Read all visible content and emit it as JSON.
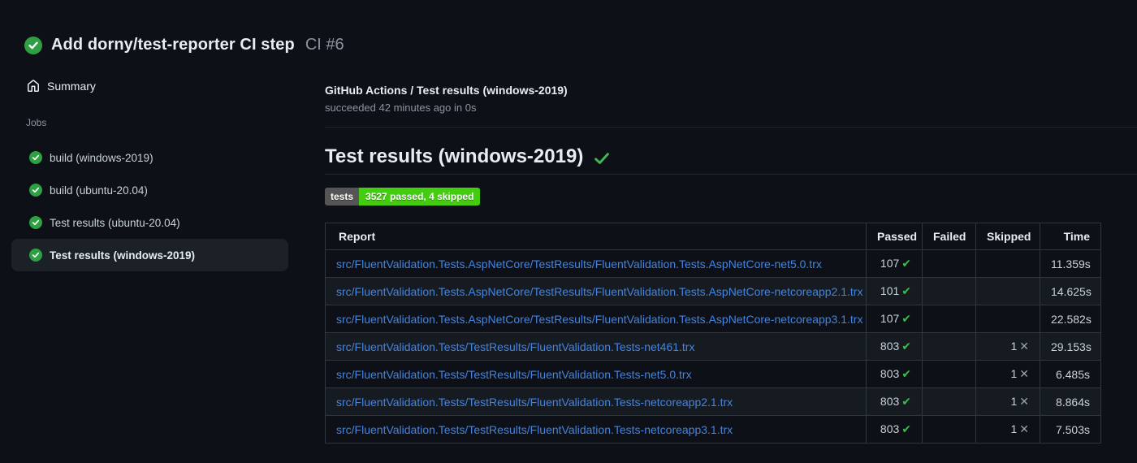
{
  "colors": {
    "background": "#0d1117",
    "selected_item_bg": "#1c2128",
    "text_primary": "#e6edf3",
    "text_secondary": "#8b949e",
    "link_blue": "#4184e4",
    "success_green": "#3fb950",
    "status_circle_green": "#2ea043",
    "badge_label_bg": "#555555",
    "badge_value_bg": "#44cc11",
    "table_border": "#30363d",
    "row_alt_bg": "#161b22"
  },
  "header": {
    "title": "Add dorny/test-reporter CI step",
    "run_number": "CI #6"
  },
  "sidebar": {
    "summary_label": "Summary",
    "jobs_section_label": "Jobs",
    "jobs": [
      {
        "label": "build (windows-2019)",
        "status": "success",
        "selected": false
      },
      {
        "label": "build (ubuntu-20.04)",
        "status": "success",
        "selected": false
      },
      {
        "label": "Test results (ubuntu-20.04)",
        "status": "success",
        "selected": false
      },
      {
        "label": "Test results (windows-2019)",
        "status": "success",
        "selected": true
      }
    ]
  },
  "main": {
    "check_title": "GitHub Actions / Test results (windows-2019)",
    "check_subtitle": "succeeded 42 minutes ago in 0s",
    "section_heading": "Test results (windows-2019)",
    "badge": {
      "label": "tests",
      "value": "3527 passed, 4 skipped"
    },
    "table": {
      "headers": [
        "Report",
        "Passed",
        "Failed",
        "Skipped",
        "Time"
      ],
      "rows": [
        {
          "report": "src/FluentValidation.Tests.AspNetCore/TestResults/FluentValidation.Tests.AspNetCore-net5.0.trx",
          "passed": "107",
          "failed": "",
          "skipped": "",
          "time": "11.359s"
        },
        {
          "report": "src/FluentValidation.Tests.AspNetCore/TestResults/FluentValidation.Tests.AspNetCore-netcoreapp2.1.trx",
          "passed": "101",
          "failed": "",
          "skipped": "",
          "time": "14.625s"
        },
        {
          "report": "src/FluentValidation.Tests.AspNetCore/TestResults/FluentValidation.Tests.AspNetCore-netcoreapp3.1.trx",
          "passed": "107",
          "failed": "",
          "skipped": "",
          "time": "22.582s"
        },
        {
          "report": "src/FluentValidation.Tests/TestResults/FluentValidation.Tests-net461.trx",
          "passed": "803",
          "failed": "",
          "skipped": "1",
          "time": "29.153s"
        },
        {
          "report": "src/FluentValidation.Tests/TestResults/FluentValidation.Tests-net5.0.trx",
          "passed": "803",
          "failed": "",
          "skipped": "1",
          "time": "6.485s"
        },
        {
          "report": "src/FluentValidation.Tests/TestResults/FluentValidation.Tests-netcoreapp2.1.trx",
          "passed": "803",
          "failed": "",
          "skipped": "1",
          "time": "8.864s"
        },
        {
          "report": "src/FluentValidation.Tests/TestResults/FluentValidation.Tests-netcoreapp3.1.trx",
          "passed": "803",
          "failed": "",
          "skipped": "1",
          "time": "7.503s"
        }
      ]
    }
  }
}
